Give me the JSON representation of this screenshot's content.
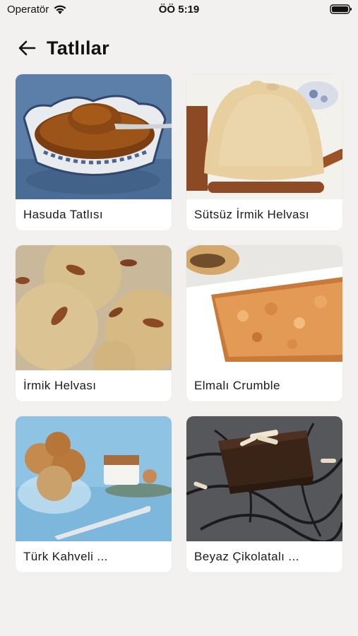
{
  "status": {
    "carrier": "Operatör",
    "time": "ÖÖ 5:19",
    "icons": [
      "wifi-icon",
      "battery-icon"
    ]
  },
  "header": {
    "back_icon": "arrow-left-icon",
    "title": "Tatlılar"
  },
  "recipes": [
    {
      "title": "Hasuda Tatlısı",
      "image": "caramel pudding in patterned bowl"
    },
    {
      "title": "Sütsüz İrmik Helvası",
      "image": "semolina halva mound with cinnamon sticks"
    },
    {
      "title": "İrmik Helvası",
      "image": "semolina halva balls with pecans"
    },
    {
      "title": "Elmalı Crumble",
      "image": "apple crumble in white dish"
    },
    {
      "title": "Türk Kahveli ...",
      "image": "cookies in glass bowl with coffee cup"
    },
    {
      "title": "Beyaz Çikolatalı ...",
      "image": "brownie with white chocolate shavings"
    }
  ],
  "colors": {
    "background": "#f2f1f0",
    "card": "#ffffff",
    "text": "#111111"
  }
}
